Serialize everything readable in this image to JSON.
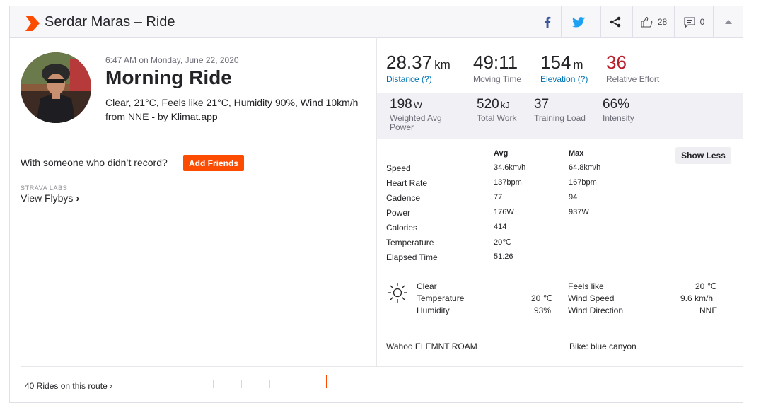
{
  "header": {
    "title": "Serdar Maras – Ride",
    "kudos_count": "28",
    "comments_count": "0"
  },
  "activity": {
    "time": "6:47 AM on Monday, June 22, 2020",
    "title": "Morning Ride",
    "description": "Clear, 21°C, Feels like 21°C, Humidity 90%, Wind 10km/h from NNE - by Klimat.app"
  },
  "friends": {
    "question": "With someone who didn’t record?",
    "button": "Add Friends"
  },
  "labs": {
    "label": "STRAVA LABS",
    "flybys": "View Flybys"
  },
  "primary_stats": [
    {
      "value": "28.37",
      "unit": "km",
      "label": "Distance (?)"
    },
    {
      "value": "49:11",
      "unit": "",
      "label": "Moving Time"
    },
    {
      "value": "154",
      "unit": "m",
      "label": "Elevation (?)"
    },
    {
      "value": "36",
      "unit": "",
      "label": "Relative Effort"
    }
  ],
  "secondary_stats": [
    {
      "value": "198",
      "unit": "W",
      "label": "Weighted Avg Power"
    },
    {
      "value": "520",
      "unit": "kJ",
      "label": "Total Work"
    },
    {
      "value": "37",
      "unit": "",
      "label": "Training Load"
    },
    {
      "value": "66%",
      "unit": "",
      "label": "Intensity"
    }
  ],
  "details": {
    "show_less": "Show Less",
    "avg_header": "Avg",
    "max_header": "Max",
    "rows": [
      {
        "name": "Speed",
        "avg": "34.6km/h",
        "max": "64.8km/h"
      },
      {
        "name": "Heart Rate",
        "avg": "137bpm",
        "max": "167bpm"
      },
      {
        "name": "Cadence",
        "avg": "77",
        "max": "94"
      },
      {
        "name": "Power",
        "avg": "176W",
        "max": "937W"
      },
      {
        "name": "Calories",
        "avg": "414",
        "max": ""
      },
      {
        "name": "Temperature",
        "avg": "20℃",
        "max": ""
      },
      {
        "name": "Elapsed Time",
        "avg": "51:26",
        "max": ""
      }
    ]
  },
  "weather": {
    "condition": "Clear",
    "temperature_label": "Temperature",
    "temperature_value": "20 ℃",
    "humidity_label": "Humidity",
    "humidity_value": "93%",
    "feels_like_label": "Feels like",
    "feels_like_value": "20 ℃",
    "wind_speed_label": "Wind Speed",
    "wind_speed_value": "9.6 km/h",
    "wind_direction_label": "Wind Direction",
    "wind_direction_value": "NNE"
  },
  "equipment": {
    "device": "Wahoo ELEMNT ROAM",
    "bike": "Bike: blue canyon"
  },
  "routes": {
    "label": "40 Rides on this route"
  },
  "colors": {
    "brand_orange": "#fc4c02",
    "link_blue": "#0073b1",
    "effort_red": "#b71f2b"
  }
}
